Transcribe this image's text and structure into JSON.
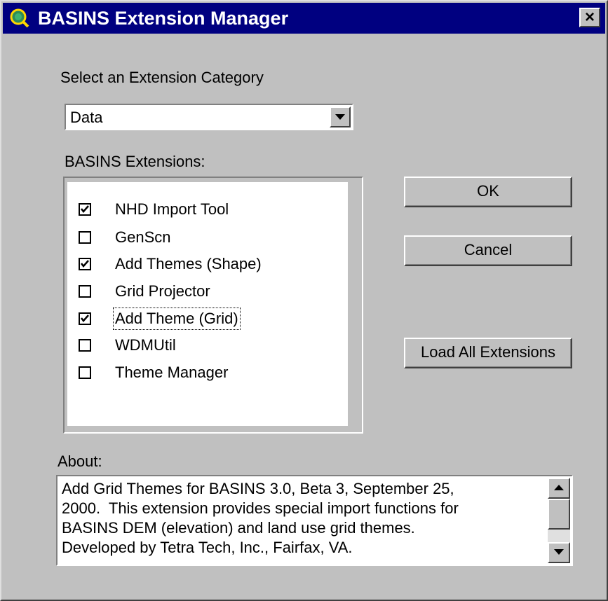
{
  "window": {
    "title": "BASINS Extension Manager",
    "close_label": "×"
  },
  "category": {
    "label": "Select an Extension Category",
    "selected": "Data"
  },
  "extensions": {
    "label": "BASINS Extensions:",
    "items": [
      {
        "label": "NHD Import Tool",
        "checked": true
      },
      {
        "label": "GenScn",
        "checked": false
      },
      {
        "label": "Add Themes (Shape)",
        "checked": true
      },
      {
        "label": "Grid Projector",
        "checked": false
      },
      {
        "label": "Add Theme (Grid)",
        "checked": true,
        "focused": true
      },
      {
        "label": "WDMUtil",
        "checked": false
      },
      {
        "label": "Theme Manager",
        "checked": false
      }
    ]
  },
  "buttons": {
    "ok": "OK",
    "cancel": "Cancel",
    "load_all": "Load All Extensions"
  },
  "about": {
    "label": "About:",
    "text": "Add Grid Themes for BASINS 3.0, Beta 3, September 25,\n2000.  This extension provides special import functions for\nBASINS DEM (elevation) and land use grid themes.\nDeveloped by Tetra Tech, Inc., Fairfax, VA."
  },
  "colors": {
    "titlebar": "#000080",
    "face": "#c0c0c0"
  },
  "icons": {
    "app": "globe-magnifier-icon",
    "combo": "chevron-down-icon",
    "scroll_up": "scroll-up-icon",
    "scroll_down": "scroll-down-icon"
  }
}
